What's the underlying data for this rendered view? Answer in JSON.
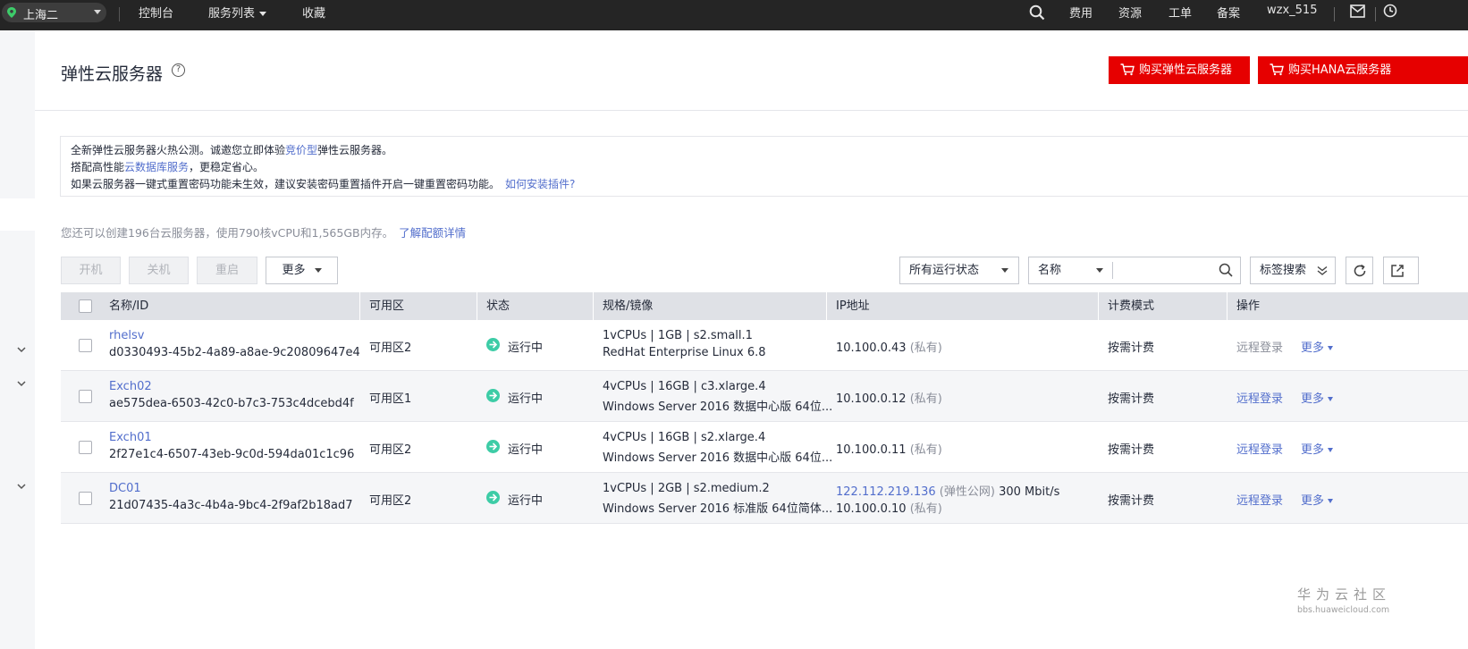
{
  "topbar": {
    "region": "上海二",
    "nav": [
      "控制台",
      "服务列表",
      "收藏"
    ],
    "right_items": [
      "费用",
      "资源",
      "工单",
      "备案",
      "wzx_515"
    ]
  },
  "header": {
    "title": "弹性云服务器",
    "help_icon": "?",
    "buy_ecs_label": "购买弹性云服务器",
    "buy_hana_label": "购买HANA云服务器"
  },
  "notice": {
    "line1_a": "全新弹性云服务器火热公测。诚邀您立即体验",
    "line1_link": "竞价型",
    "line1_b": "弹性云服务器。",
    "line2_a": "搭配高性能",
    "line2_link": "云数据库服务",
    "line2_b": "，更稳定省心。",
    "line3_a": "如果云服务器一键式重置密码功能未生效，建议安装密码重置插件开启一键重置密码功能。",
    "line3_link": "如何安装插件?"
  },
  "quota": {
    "text": "您还可以创建196台云服务器，使用790核vCPU和1,565GB内存。",
    "link": "了解配额详情"
  },
  "toolbar": {
    "start": "开机",
    "stop": "关机",
    "restart": "重启",
    "more": "更多",
    "status_filter": "所有运行状态",
    "search_field": "名称",
    "search_placeholder": "",
    "tag_search": "标签搜索"
  },
  "table": {
    "headers": [
      "名称/ID",
      "可用区",
      "状态",
      "规格/镜像",
      "IP地址",
      "计费模式",
      "操作"
    ],
    "rows": [
      {
        "name": "rhelsv",
        "id": "d0330493-45b2-4a89-a8ae-9c20809647e4",
        "zone": "可用区2",
        "status": "运行中",
        "spec": "1vCPUs | 1GB | s2.small.1",
        "image": "RedHat Enterprise Linux 6.8",
        "ip1": "10.100.0.43",
        "ip1_tag": "(私有)",
        "ip2": "",
        "ip2_tag": "",
        "ip1_bw": "",
        "billing": "按需计费",
        "remote": "远程登录",
        "more": "更多"
      },
      {
        "name": "Exch02",
        "id": "ae575dea-6503-42c0-b7c3-753c4dcebd4f",
        "zone": "可用区1",
        "status": "运行中",
        "spec": "4vCPUs | 16GB | c3.xlarge.4",
        "image": "Windows Server 2016 数据中心版 64位...",
        "ip1": "10.100.0.12",
        "ip1_tag": "(私有)",
        "ip2": "",
        "ip2_tag": "",
        "ip1_bw": "",
        "billing": "按需计费",
        "remote": "远程登录",
        "more": "更多"
      },
      {
        "name": "Exch01",
        "id": "2f27e1c4-6507-43eb-9c0d-594da01c1c96",
        "zone": "可用区2",
        "status": "运行中",
        "spec": "4vCPUs | 16GB | s2.xlarge.4",
        "image": "Windows Server 2016 数据中心版 64位...",
        "ip1": "10.100.0.11",
        "ip1_tag": "(私有)",
        "ip2": "",
        "ip2_tag": "",
        "ip1_bw": "",
        "billing": "按需计费",
        "remote": "远程登录",
        "more": "更多"
      },
      {
        "name": "DC01",
        "id": "21d07435-4a3c-4b4a-9bc4-2f9af2b18ad7",
        "zone": "可用区2",
        "status": "运行中",
        "spec": "1vCPUs | 2GB | s2.medium.2",
        "image": "Windows Server 2016 标准版 64位简体...",
        "ip1": "122.112.219.136",
        "ip1_tag": "(弹性公网)",
        "ip1_bw": "300 Mbit/s",
        "ip2": "10.100.0.10",
        "ip2_tag": "(私有)",
        "billing": "按需计费",
        "remote": "远程登录",
        "more": "更多"
      }
    ]
  },
  "watermark": {
    "title": "华为云社区",
    "url": "bbs.huaweicloud.com"
  },
  "colors": {
    "topbar": "#252525",
    "accent_red": "#e60000",
    "link_blue": "#526ecc",
    "running_green": "#3dcca6"
  }
}
